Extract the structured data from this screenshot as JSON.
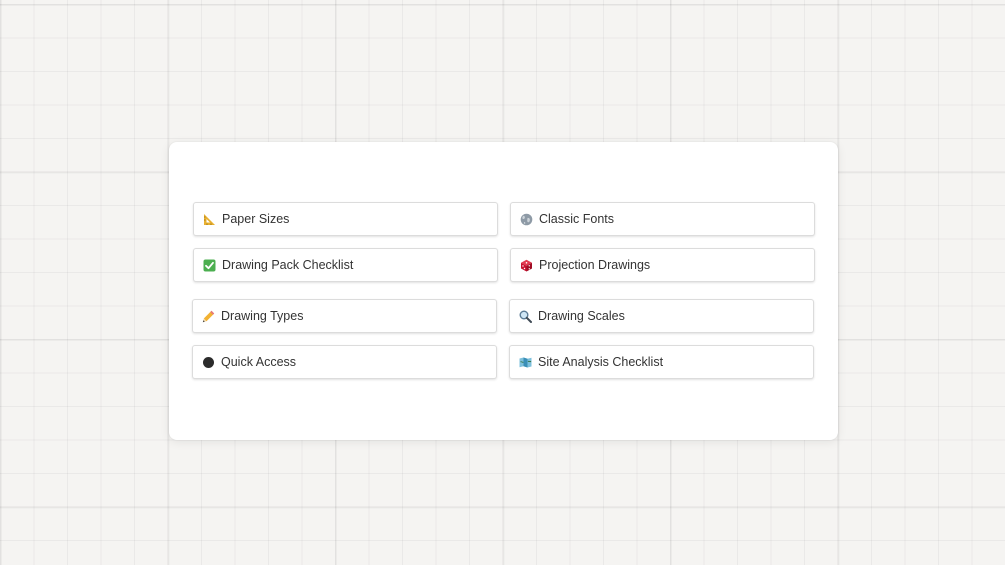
{
  "cards": [
    {
      "label": "Paper Sizes",
      "icon": "triangular-ruler-icon"
    },
    {
      "label": "Classic Fonts",
      "icon": "globe-icon"
    },
    {
      "label": "Drawing Pack Checklist",
      "icon": "check-box-icon"
    },
    {
      "label": "Projection Drawings",
      "icon": "dice-icon"
    },
    {
      "label": "Drawing Types",
      "icon": "pencil-icon"
    },
    {
      "label": "Drawing Scales",
      "icon": "magnifier-icon"
    },
    {
      "label": "Quick Access",
      "icon": "black-circle-icon"
    },
    {
      "label": "Site Analysis Checklist",
      "icon": "map-icon"
    }
  ],
  "colors": {
    "background": "#f5f4f2",
    "panel": "#ffffff",
    "card_border": "#dcdcdc",
    "text": "#333333",
    "check_green": "#4caf50",
    "dice_red": "#c8102e",
    "ruler_yellow": "#e8b030",
    "map_teal": "#3a8fb7"
  }
}
